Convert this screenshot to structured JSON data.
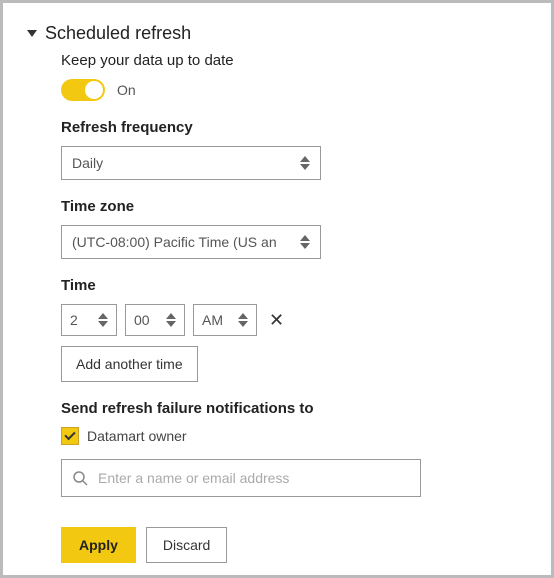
{
  "section": {
    "title": "Scheduled refresh",
    "keepDataLabel": "Keep your data up to date",
    "toggle": {
      "state": "On"
    },
    "frequency": {
      "label": "Refresh frequency",
      "value": "Daily"
    },
    "timezone": {
      "label": "Time zone",
      "value": "(UTC-08:00) Pacific Time (US an"
    },
    "time": {
      "label": "Time",
      "hour": "2",
      "minute": "00",
      "ampm": "AM",
      "addAnother": "Add another time"
    },
    "notifications": {
      "label": "Send refresh failure notifications to",
      "checkboxLabel": "Datamart owner",
      "inputPlaceholder": "Enter a name or email address"
    },
    "buttons": {
      "apply": "Apply",
      "discard": "Discard"
    }
  }
}
